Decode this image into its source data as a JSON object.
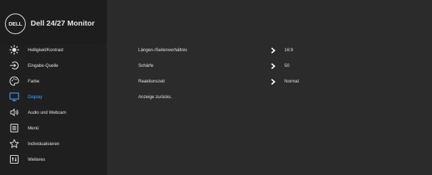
{
  "header": {
    "logo_text": "DELL",
    "title": "Dell 24/27 Monitor"
  },
  "sidebar": {
    "items": [
      {
        "label": "Helligkeit/Kontrast",
        "icon": "brightness-icon",
        "active": false
      },
      {
        "label": "Eingabe-Quelle",
        "icon": "input-source-icon",
        "active": false
      },
      {
        "label": "Farbe",
        "icon": "color-icon",
        "active": false
      },
      {
        "label": "Display",
        "icon": "display-icon",
        "active": true
      },
      {
        "label": "Audio und Webcam",
        "icon": "audio-icon",
        "active": false
      },
      {
        "label": "Menü",
        "icon": "menu-icon",
        "active": false
      },
      {
        "label": "Individualisieren",
        "icon": "star-icon",
        "active": false
      },
      {
        "label": "Weiteres",
        "icon": "others-icon",
        "active": false
      }
    ]
  },
  "main": {
    "rows": [
      {
        "label": "Längen-/Seitenverhältnis",
        "has_arrow": true,
        "value": "16:9"
      },
      {
        "label": "Schärfe",
        "has_arrow": true,
        "value": "50"
      },
      {
        "label": "Reaktionszeit",
        "has_arrow": true,
        "value": "Normal"
      },
      {
        "label": "Anzeige zurücks.",
        "has_arrow": false,
        "value": ""
      }
    ]
  },
  "colors": {
    "background": "#2b2b2b",
    "sidebar": "#1f1f1f",
    "accent": "#4da3ff",
    "text": "#e6e6e6"
  }
}
